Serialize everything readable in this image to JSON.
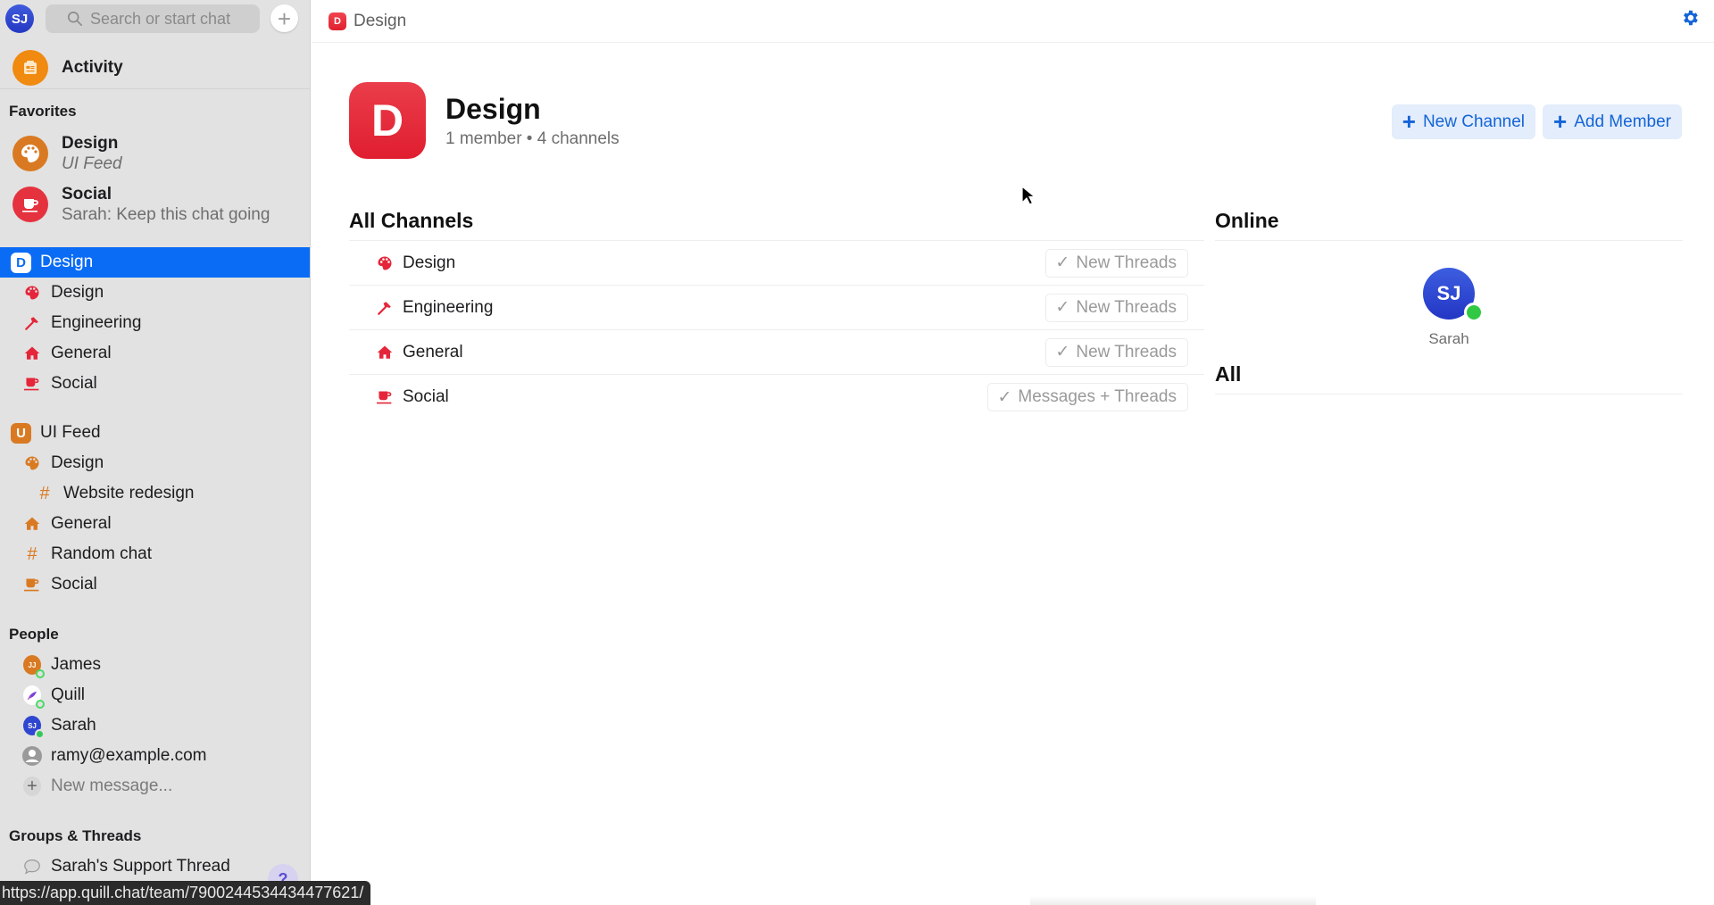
{
  "sidebar": {
    "user_avatar_initials": "SJ",
    "search": {
      "placeholder": "Search or start chat"
    },
    "new_chat_label": "+",
    "activity": {
      "label": "Activity",
      "color": "#f08a10"
    },
    "favorites": {
      "title": "Favorites",
      "items": [
        {
          "title": "Design",
          "subtitle": "UI Feed",
          "icon": "palette-icon",
          "color": "#d97a22"
        },
        {
          "title": "Social",
          "subtitle": "Sarah: Keep this chat going",
          "icon": "coffee-cup-icon",
          "color": "#e5323f"
        }
      ]
    },
    "teams": [
      {
        "name": "Design",
        "badge": "D",
        "selected": true,
        "accent": "#e5263a",
        "channels": [
          {
            "label": "Design",
            "icon": "palette-icon"
          },
          {
            "label": "Engineering",
            "icon": "hammer-icon"
          },
          {
            "label": "General",
            "icon": "house-icon"
          },
          {
            "label": "Social",
            "icon": "coffee-cup-icon"
          }
        ]
      },
      {
        "name": "UI Feed",
        "badge": "U",
        "selected": false,
        "accent": "#d97a22",
        "channels": [
          {
            "label": "Design",
            "icon": "palette-icon"
          },
          {
            "label": "Website redesign",
            "icon": "hash-icon",
            "nested": true
          },
          {
            "label": "General",
            "icon": "house-icon"
          },
          {
            "label": "Random chat",
            "icon": "hash-icon"
          },
          {
            "label": "Social",
            "icon": "coffee-cup-icon"
          }
        ]
      }
    ],
    "people": {
      "title": "People",
      "items": [
        {
          "name": "James",
          "initials": "JJ",
          "color": "#d97a22",
          "status": "online-ring"
        },
        {
          "name": "Quill",
          "initials": "",
          "color": "#ffffff",
          "status": "online-ring"
        },
        {
          "name": "Sarah",
          "initials": "SJ",
          "color": "#2f46d0",
          "status": "online"
        },
        {
          "name": "ramy@example.com",
          "initials": "",
          "color": "#9a9a9a",
          "status": "none"
        }
      ],
      "new_message_label": "New message..."
    },
    "groups": {
      "title": "Groups & Threads",
      "items": [
        {
          "label": "Sarah's Support Thread",
          "icon": "speech-bubble-icon"
        }
      ]
    },
    "help_label": "?"
  },
  "status_url": "https://app.quill.chat/team/7900244534434477621/",
  "main": {
    "breadcrumb": {
      "badge": "D",
      "label": "Design"
    },
    "team": {
      "logo_letter": "D",
      "name": "Design",
      "summary": "1 member • 4 channels"
    },
    "actions": {
      "new_channel": "New Channel",
      "add_member": "Add Member",
      "accent": "#1464d8"
    },
    "all_channels": {
      "title": "All Channels",
      "rows": [
        {
          "label": "Design",
          "icon": "palette-icon",
          "notify": "New Threads"
        },
        {
          "label": "Engineering",
          "icon": "hammer-icon",
          "notify": "New Threads"
        },
        {
          "label": "General",
          "icon": "house-icon",
          "notify": "New Threads"
        },
        {
          "label": "Social",
          "icon": "coffee-cup-icon",
          "notify": "Messages + Threads"
        }
      ]
    },
    "members": {
      "online_title": "Online",
      "online": [
        {
          "name": "Sarah",
          "initials": "SJ"
        }
      ],
      "all_title": "All"
    }
  }
}
